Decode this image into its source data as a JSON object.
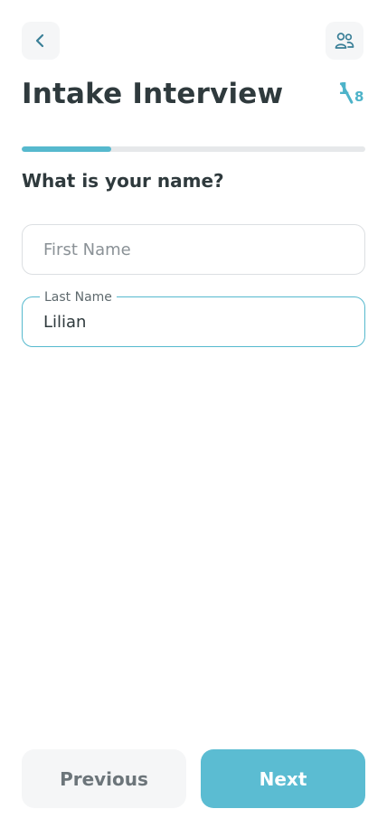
{
  "header": {
    "title": "Intake Interview",
    "step": {
      "current": "1",
      "total": "8"
    },
    "back_icon": "chevron-left-icon",
    "users_icon": "users-icon"
  },
  "progress": {
    "value": 0.26
  },
  "question": "What is your name?",
  "form": {
    "first_name": {
      "placeholder": "First Name",
      "value": ""
    },
    "last_name": {
      "label": "Last Name",
      "value": "Lilian"
    }
  },
  "footer": {
    "previous_label": "Previous",
    "next_label": "Next"
  },
  "colors": {
    "accent": "#56b9ce",
    "text": "#2f3a3d",
    "muted": "#8a9196"
  }
}
